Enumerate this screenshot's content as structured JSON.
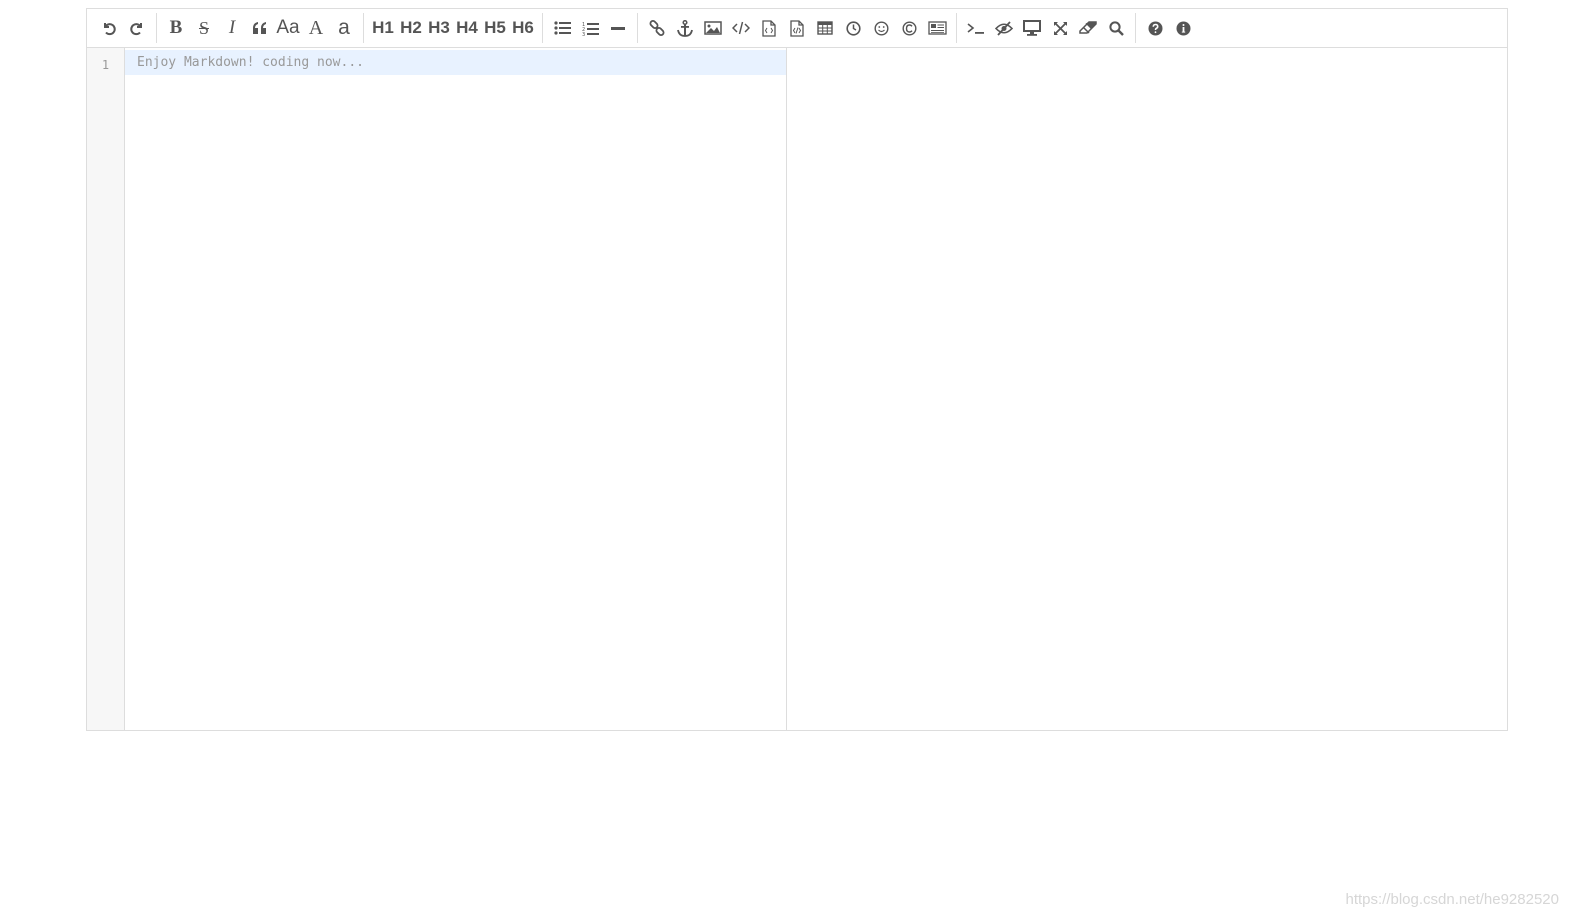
{
  "toolbar": {
    "undo_icon": "undo-icon",
    "redo_icon": "redo-icon",
    "bold_label": "B",
    "strike_label": "S",
    "italic_label": "I",
    "quote_icon": "quote-icon",
    "ucwords_label": "Aa",
    "uppercase_label": "A",
    "lowercase_label": "a",
    "headings": [
      "H1",
      "H2",
      "H3",
      "H4",
      "H5",
      "H6"
    ],
    "icons_group3": [
      "unordered-list-icon",
      "ordered-list-icon",
      "horizontal-rule-icon"
    ],
    "icons_group4": [
      "link-icon",
      "anchor-icon",
      "image-icon",
      "code-icon",
      "preformatted-code-icon",
      "code-block-icon",
      "table-icon",
      "datetime-icon",
      "emoji-icon",
      "html-entities-icon",
      "pagebreak-icon"
    ],
    "icons_group5": [
      "goto-line-icon",
      "watch-toggle-icon",
      "preview-icon",
      "fullscreen-icon",
      "clear-icon",
      "search-icon"
    ],
    "icons_group6": [
      "help-icon",
      "info-icon"
    ]
  },
  "editor": {
    "line_number": "1",
    "placeholder": "Enjoy Markdown! coding now..."
  },
  "watermark": "https://blog.csdn.net/he9282520"
}
